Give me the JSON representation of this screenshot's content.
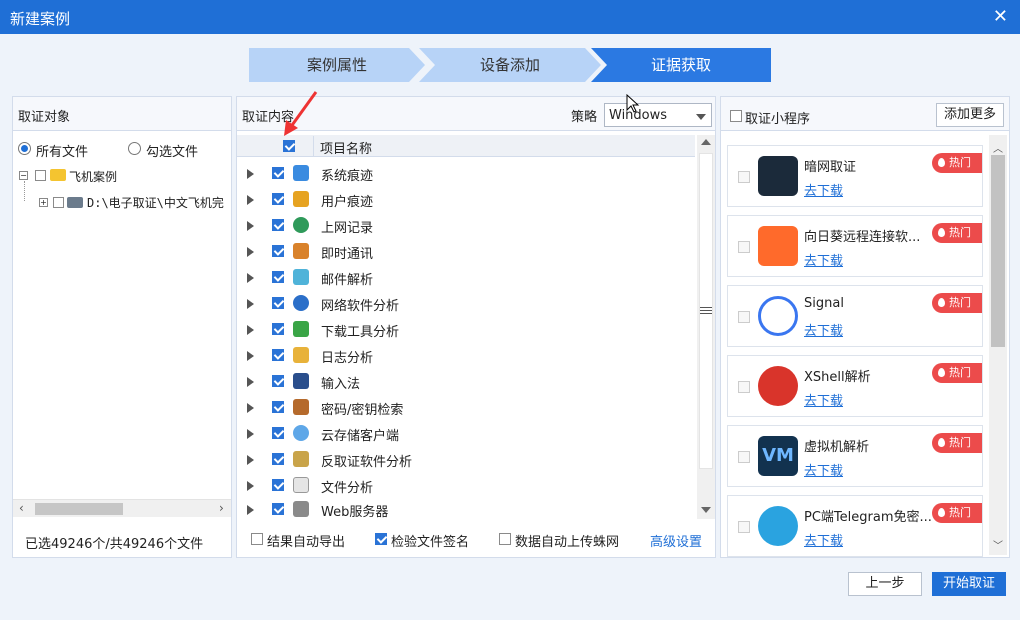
{
  "window": {
    "title": "新建案例"
  },
  "steps": [
    "案例属性",
    "设备添加",
    "证据获取"
  ],
  "left": {
    "title": "取证对象",
    "radio_all": "所有文件",
    "radio_sel": "勾选文件",
    "tree_root": "飞机案例",
    "tree_child": "D:\\电子取证\\中文飞机完",
    "status": "已选49246个/共49246个文件"
  },
  "middle": {
    "title": "取证内容",
    "strategy_label": "策略",
    "strategy_value": "Windows",
    "col_header": "项目名称",
    "items": [
      "系统痕迹",
      "用户痕迹",
      "上网记录",
      "即时通讯",
      "邮件解析",
      "网络软件分析",
      "下载工具分析",
      "日志分析",
      "输入法",
      "密码/密钥检索",
      "云存储客户端",
      "反取证软件分析",
      "文件分析",
      "Web服务器"
    ],
    "opt_export": "结果自动导出",
    "opt_sign": "检验文件签名",
    "opt_upload": "数据自动上传蛛网",
    "advanced": "高级设置"
  },
  "right": {
    "title": "取证小程序",
    "add_more": "添加更多",
    "hot_label": "热门",
    "download_label": "去下载",
    "apps": [
      {
        "name": "暗网取证",
        "color": "#1b2a3a"
      },
      {
        "name": "向日葵远程连接软...",
        "color": "#ff6a2b"
      },
      {
        "name": "Signal",
        "color": "#3a76f0"
      },
      {
        "name": "XShell解析",
        "color": "#d9342b"
      },
      {
        "name": "虚拟机解析",
        "color": "#12324f"
      },
      {
        "name": "PC端Telegram免密...",
        "color": "#2aa3e0"
      }
    ]
  },
  "footer": {
    "prev": "上一步",
    "start": "开始取证"
  }
}
